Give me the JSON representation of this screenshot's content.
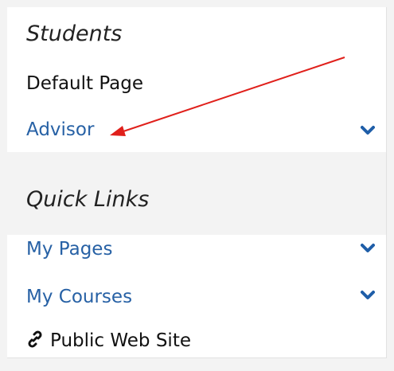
{
  "sections": [
    {
      "heading": "Students",
      "items": [
        {
          "label": "Default Page"
        },
        {
          "label": "Advisor"
        }
      ]
    },
    {
      "heading": "Quick Links",
      "items": [
        {
          "label": "My Pages"
        },
        {
          "label": "My Courses"
        },
        {
          "label": "Public Web Site"
        }
      ]
    }
  ],
  "icons": {
    "expand": "chevron-down-icon",
    "external": "link-icon",
    "annotation": "red-arrow-annotation"
  },
  "colors": {
    "link": "#2761a5",
    "chevron": "#1f5ea8",
    "annotation": "#e0201b",
    "band": "#f3f3f3"
  }
}
